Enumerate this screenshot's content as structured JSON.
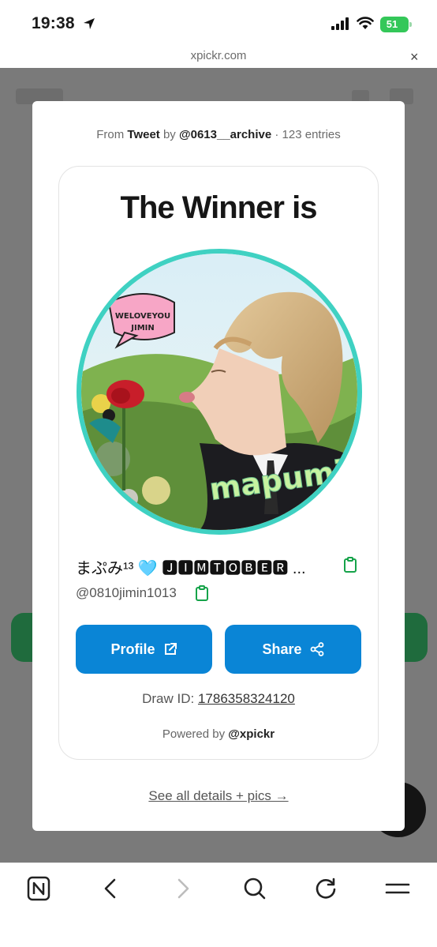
{
  "status_bar": {
    "time": "19:38",
    "battery": "51",
    "icons": [
      "location-arrow-icon",
      "cellular-signal-icon",
      "wifi-icon",
      "battery-icon"
    ]
  },
  "browser": {
    "url": "xpickr.com",
    "close_glyph": "×"
  },
  "modal": {
    "source": {
      "prefix": "From",
      "platform": "Tweet",
      "by": "by",
      "handle": "@0613__archive",
      "entries": "· 123 entries"
    },
    "title": "The Winner is",
    "avatar": {
      "sticker_line1": "WELOVEYOU",
      "sticker_line2": "JIMIN",
      "caption": "mapumi"
    },
    "winner": {
      "name": "まぷみ¹³ 🩵 🅹🅸🅼🆃🅾🅱🅴🆁 ...",
      "handle": "@0810jimin1013"
    },
    "buttons": {
      "profile": "Profile",
      "share": "Share"
    },
    "draw_id": {
      "label": "Draw ID:",
      "value": "1786358324120"
    },
    "powered": {
      "prefix": "Powered by",
      "handle": "@xpickr"
    },
    "see_all": "See all details + pics →",
    "accent_color": "#0a85d6",
    "ring_color": "#3fd1c2",
    "copy_icon_color": "#16a34a"
  },
  "toolbar": {
    "icons": [
      "naver-n-icon",
      "back-arrow-icon",
      "forward-arrow-icon",
      "search-icon",
      "reload-icon",
      "menu-icon"
    ]
  }
}
